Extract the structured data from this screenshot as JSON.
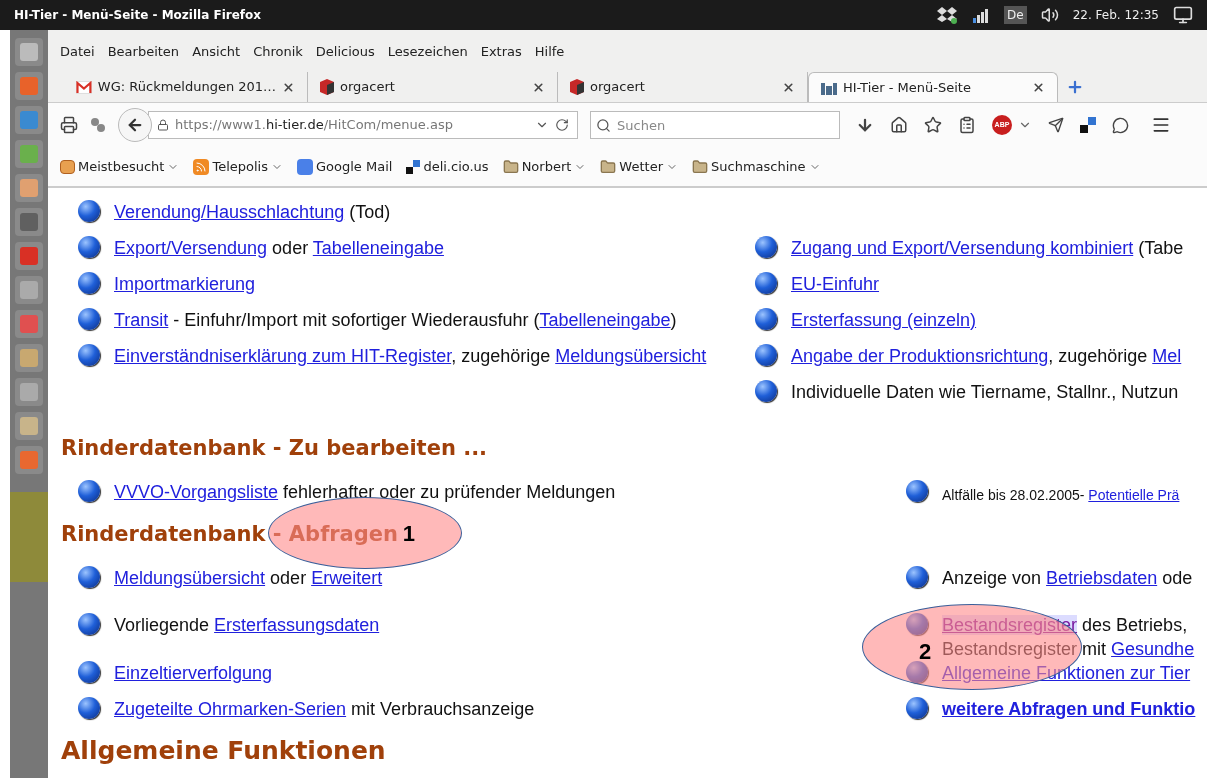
{
  "window": {
    "title": "HI-Tier - Menü-Seite - Mozilla Firefox"
  },
  "indicators": {
    "keyboard": "De",
    "clock": "22. Feb. 12:35"
  },
  "menu": [
    "Datei",
    "Bearbeiten",
    "Ansicht",
    "Chronik",
    "Delicious",
    "Lesezeichen",
    "Extras",
    "Hilfe"
  ],
  "tabs": [
    {
      "label": "WG: Rückmeldungen 201…",
      "selected": false
    },
    {
      "label": "orgacert",
      "selected": false
    },
    {
      "label": "orgacert",
      "selected": false
    },
    {
      "label": "HI-Tier - Menü-Seite",
      "selected": true
    }
  ],
  "toolbar": {
    "url": {
      "prefix": "https://www1.",
      "domain": "hi-tier.de",
      "path": "/HitCom/menue.asp"
    },
    "search_placeholder": "Suchen",
    "adblock_badge": "ABP"
  },
  "bookmarks": [
    {
      "label": "Meistbesucht",
      "dropdown": true
    },
    {
      "label": "Telepolis",
      "dropdown": true
    },
    {
      "label": "Google Mail",
      "dropdown": false
    },
    {
      "label": "deli.cio.us",
      "dropdown": false
    },
    {
      "label": "Norbert",
      "dropdown": true
    },
    {
      "label": "Wetter",
      "dropdown": true
    },
    {
      "label": "Suchmaschine",
      "dropdown": true
    }
  ],
  "sections": [
    {
      "rows": [
        {
          "left": {
            "kind": "normal",
            "lines": [
              [
                {
                  "kind": "link",
                  "text": "Verendung/Hausschlachtung"
                },
                {
                  "kind": "text",
                  "text": " (Tod)"
                }
              ]
            ]
          }
        },
        {
          "left": {
            "kind": "normal",
            "lines": [
              [
                {
                  "kind": "link",
                  "text": "Export/Versendung"
                },
                {
                  "kind": "text",
                  "text": " oder "
                },
                {
                  "kind": "link",
                  "text": "Tabelleneingabe"
                }
              ]
            ]
          },
          "right": {
            "kind": "normal",
            "lines": [
              [
                {
                  "kind": "link",
                  "text": "Zugang und Export/Versendung kombiniert"
                },
                {
                  "kind": "text",
                  "text": " (Tabe"
                }
              ]
            ]
          }
        },
        {
          "left": {
            "kind": "normal",
            "lines": [
              [
                {
                  "kind": "link",
                  "text": "Importmarkierung"
                }
              ]
            ]
          },
          "right": {
            "kind": "normal",
            "lines": [
              [
                {
                  "kind": "link",
                  "text": "EU-Einfuhr"
                }
              ]
            ]
          }
        },
        {
          "left": {
            "kind": "normal",
            "lines": [
              [
                {
                  "kind": "link",
                  "text": "Transit"
                },
                {
                  "kind": "text",
                  "text": " - Einfuhr/Import mit sofortiger Wiederausfuhr ("
                },
                {
                  "kind": "link",
                  "text": "Tabelleneingabe"
                },
                {
                  "kind": "text",
                  "text": ")"
                }
              ]
            ]
          },
          "right": {
            "kind": "normal",
            "lines": [
              [
                {
                  "kind": "link",
                  "text": "Ersterfassung (einzeln)"
                }
              ]
            ]
          }
        },
        {
          "left": {
            "kind": "normal",
            "lines": [
              [
                {
                  "kind": "link",
                  "text": "Einverständniserklärung zum HIT-Register"
                },
                {
                  "kind": "text",
                  "text": ", zugehörige "
                },
                {
                  "kind": "link",
                  "text": "Meldungsübersicht"
                }
              ]
            ]
          },
          "right": {
            "kind": "normal",
            "lines": [
              [
                {
                  "kind": "link",
                  "text": "Angabe der Produktionsrichtung"
                },
                {
                  "kind": "text",
                  "text": ", zugehörige "
                },
                {
                  "kind": "link",
                  "text": "Mel"
                }
              ]
            ]
          }
        },
        {
          "right": {
            "kind": "normal",
            "lines": [
              [
                {
                  "kind": "text",
                  "text": "Individuelle Daten wie Tiername, Stallnr., Nutzun"
                }
              ]
            ]
          }
        }
      ]
    },
    {
      "heading": "Rinderdatenbank - Zu bearbeiten ...",
      "rows": [
        {
          "left": {
            "kind": "normal",
            "lines": [
              [
                {
                  "kind": "link",
                  "text": "VVVO-Vorgangsliste"
                },
                {
                  "kind": "text",
                  "text": " fehlerhafter oder zu prüfender Meldungen"
                }
              ]
            ]
          },
          "right": {
            "kind": "small",
            "lines": [
              [
                {
                  "kind": "text",
                  "text": "Altfälle bis 28.02.2005- "
                },
                {
                  "kind": "link",
                  "text": "Potentielle Prä"
                }
              ]
            ]
          }
        }
      ]
    },
    {
      "heading": "Rinderdatenbank - Abfragen",
      "rows": [
        {
          "left": {
            "kind": "normal",
            "lines": [
              [
                {
                  "kind": "link",
                  "text": "Meldungsübersicht"
                },
                {
                  "kind": "text",
                  "text": " oder "
                },
                {
                  "kind": "link",
                  "text": "Erweitert"
                }
              ]
            ]
          },
          "right": {
            "kind": "normal",
            "lines": [
              [
                {
                  "kind": "text",
                  "text": "Anzeige von "
                },
                {
                  "kind": "link",
                  "text": "Betriebsdaten"
                },
                {
                  "kind": "text",
                  "text": " ode"
                }
              ]
            ]
          }
        },
        {
          "left": {
            "kind": "normal",
            "lines": [
              [
                {
                  "kind": "text",
                  "text": "Vorliegende "
                },
                {
                  "kind": "link",
                  "text": "Ersterfassungsdaten"
                }
              ]
            ]
          },
          "right": {
            "kind": "normal",
            "lines": [
              [
                {
                  "kind": "visited",
                  "text": "Bestandsregister"
                },
                {
                  "kind": "text",
                  "text": " des Betriebs,"
                }
              ],
              [
                {
                  "kind": "text",
                  "text": "Bestandsregister mit "
                },
                {
                  "kind": "link",
                  "text": "Gesundhe"
                }
              ]
            ]
          }
        },
        {
          "left": {
            "kind": "normal",
            "lines": [
              [
                {
                  "kind": "link",
                  "text": "Einzeltierverfolgung"
                }
              ]
            ]
          },
          "right": {
            "kind": "normal",
            "lines": [
              [
                {
                  "kind": "link",
                  "text": "Allgemeine Funktionen zur Tier"
                }
              ]
            ]
          }
        },
        {
          "left": {
            "kind": "normal",
            "lines": [
              [
                {
                  "kind": "link",
                  "text": "Zugeteilte Ohrmarken-Serien"
                },
                {
                  "kind": "text",
                  "text": " mit Verbrauchsanzeige"
                }
              ]
            ]
          },
          "right": {
            "kind": "bold",
            "lines": [
              [
                {
                  "kind": "link",
                  "text": "weitere Abfragen und Funktio"
                }
              ]
            ]
          }
        }
      ]
    },
    {
      "heading": "Allgemeine Funktionen"
    }
  ],
  "annotations": [
    {
      "label": "1"
    },
    {
      "label": "2"
    }
  ]
}
